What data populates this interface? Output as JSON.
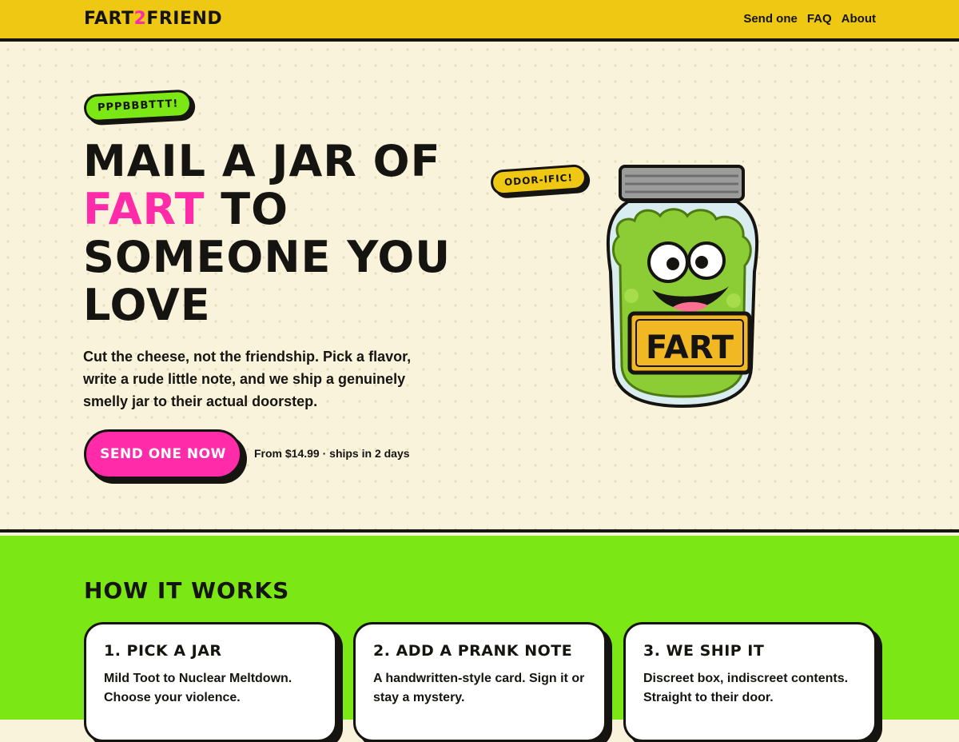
{
  "header": {
    "logo_part1": "FART",
    "logo_part2": "2",
    "logo_part3": "FRIEND",
    "nav": [
      "Send one",
      "FAQ",
      "About"
    ]
  },
  "hero": {
    "sticker_left": "PPPBBBTTT!",
    "headline_line1": "MAIL A JAR OF",
    "headline_pink": "FART",
    "headline_after_pink": " TO",
    "headline_line3": "SOMEONE YOU",
    "headline_line4": "LOVE",
    "subtext": "Cut the cheese, not the friendship. Pick a flavor, write a rude little note, and we ship a genuinely smelly jar to their actual doorstep.",
    "cta_label": "SEND ONE NOW",
    "price_note": "From $14.99 · ships in 2 days",
    "sticker_right": "ODOR-IFIC!",
    "jar_label": "FART"
  },
  "how": {
    "title": "HOW IT WORKS",
    "steps": [
      {
        "title": "1. PICK A JAR",
        "text": "Mild Toot to Nuclear Meltdown. Choose your violence."
      },
      {
        "title": "2. ADD A PRANK NOTE",
        "text": "A handwritten-style card. Sign it or stay a mystery."
      },
      {
        "title": "3. WE SHIP IT",
        "text": "Discreet box, indiscreet contents. Straight to their door."
      }
    ]
  },
  "colors": {
    "yellow": "#efc814",
    "pink": "#ff2ba8",
    "green": "#7be815",
    "cream": "#faf3dc",
    "ink": "#161410"
  }
}
